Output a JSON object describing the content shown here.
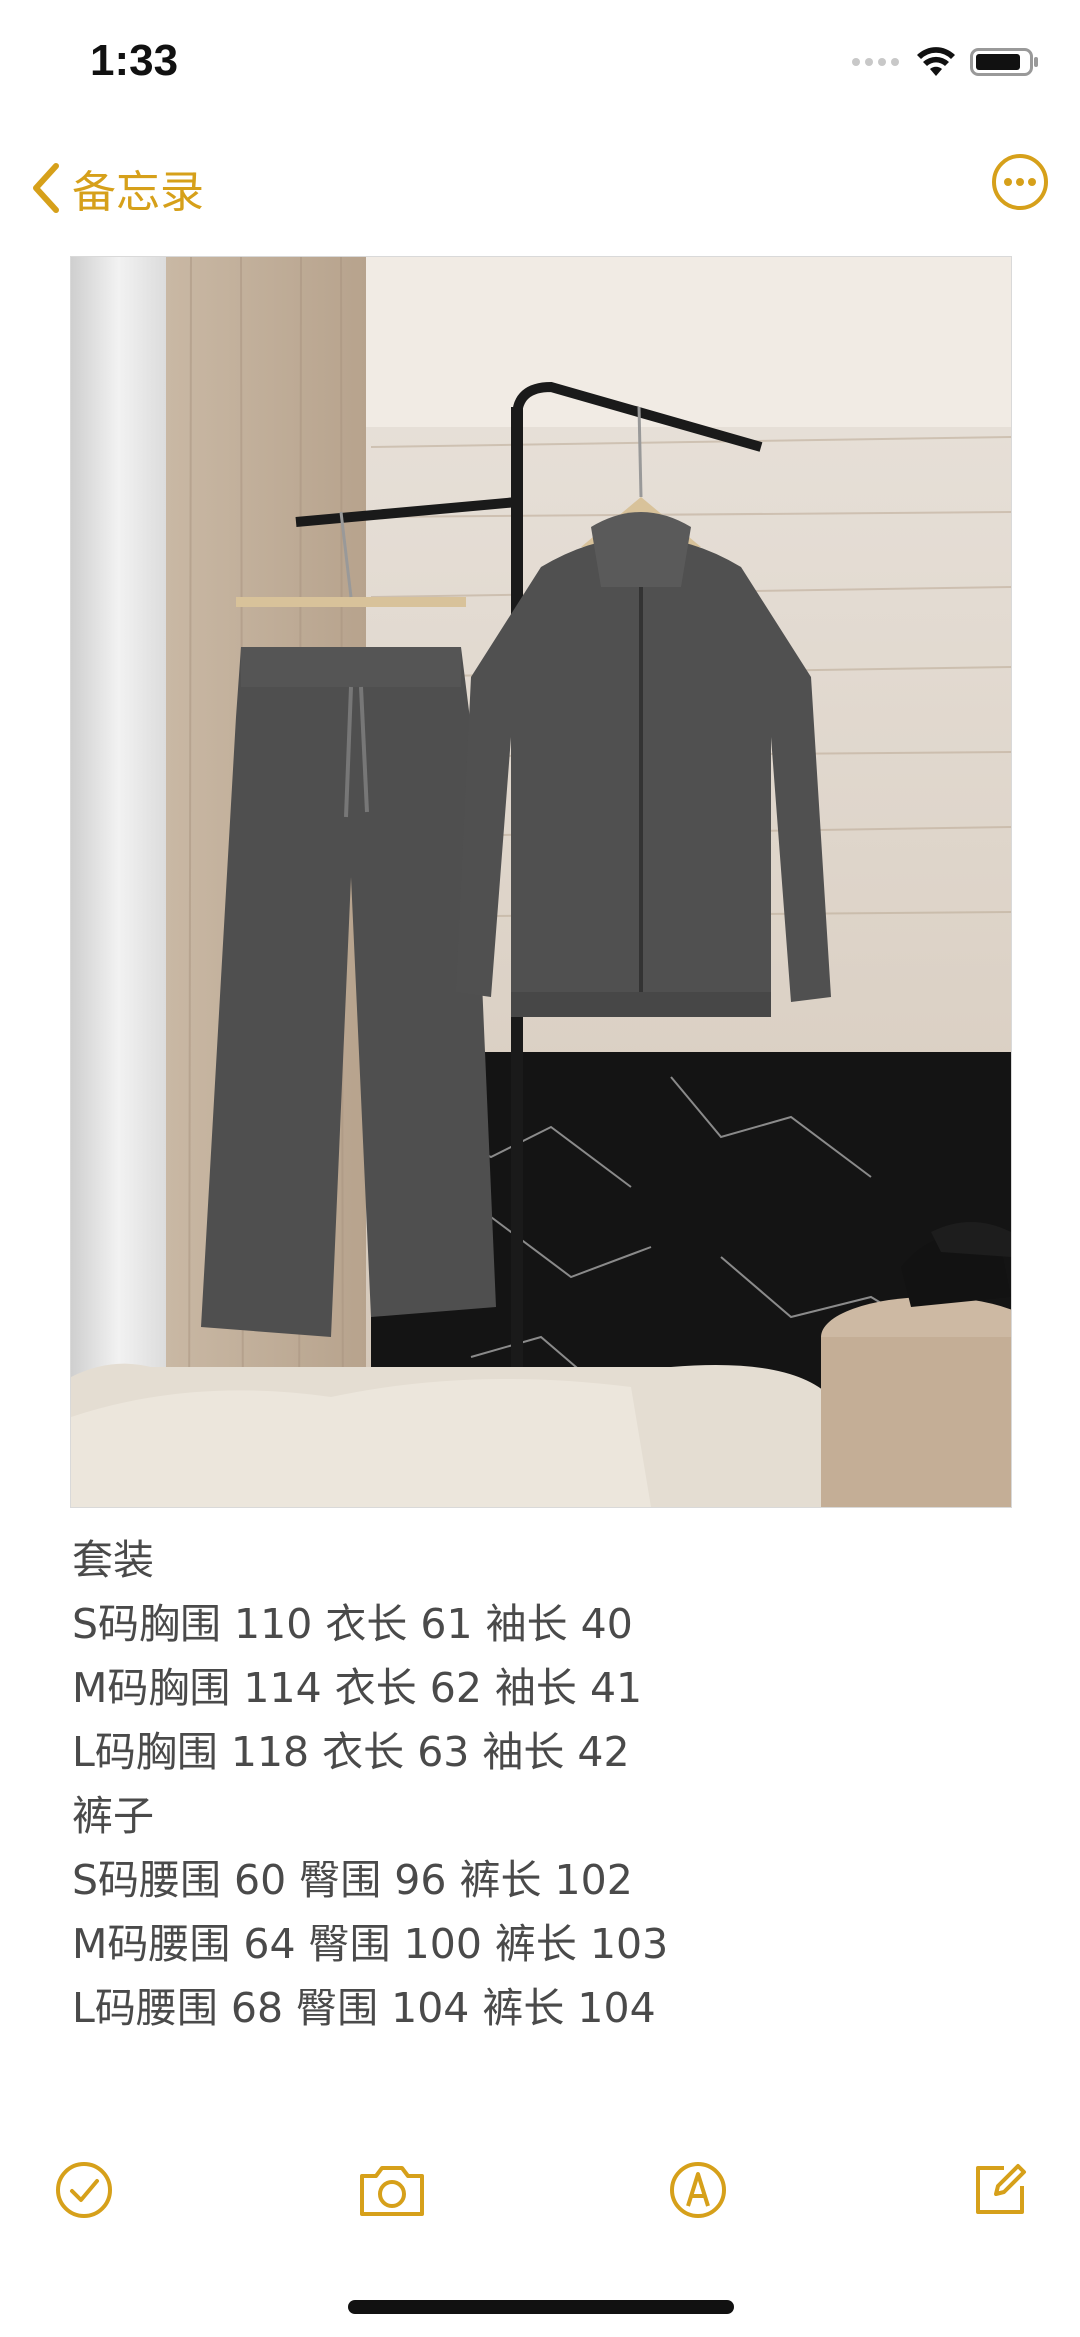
{
  "status_bar": {
    "time": "1:33"
  },
  "nav": {
    "back_label": "备忘录",
    "back_icon": "chevron-left-icon",
    "more_icon": "ellipsis-circle-icon"
  },
  "accent_color": "#d6a01a",
  "note": {
    "lines": [
      "套装",
      "S码胸围 110 衣长 61 袖长 40",
      "M码胸围 114 衣长 62 袖长 41",
      "L码胸围 118 衣长 63 袖长 42",
      "裤子",
      "S码腰围 60 臀围 96 裤长 102",
      "M码腰围 64 臀围 100 裤长 103",
      "L码腰围 68 臀围 104 裤长 104"
    ]
  },
  "toolbar": {
    "icons": [
      "checklist-icon",
      "camera-icon",
      "markup-pen-icon",
      "compose-icon"
    ]
  }
}
